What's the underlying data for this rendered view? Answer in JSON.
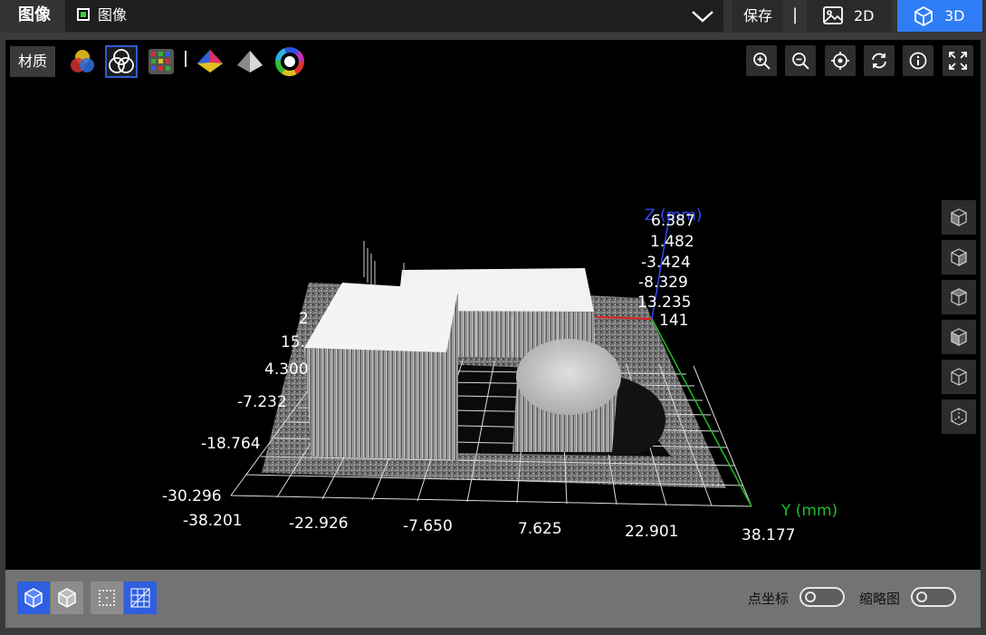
{
  "header": {
    "title": "图像",
    "image_select": {
      "label": "图像",
      "checked": true,
      "check_color": "#39d430"
    },
    "save_label": "保存",
    "separator": "|",
    "btn_2d": "2D",
    "btn_3d": "3D",
    "active_view": "3D",
    "accent": "#2f7df6"
  },
  "toolbar": {
    "material_label": "材质",
    "render_modes": [
      "rgb-channels-icon",
      "grayscale-channels-icon",
      "pseudo-color-grid-icon",
      "height-color-icon",
      "gray-shading-icon",
      "color-wheel-icon"
    ],
    "selected_mode": "grayscale-channels-icon",
    "right_tools": [
      "zoom-in-icon",
      "zoom-out-icon",
      "locate-center-icon",
      "reset-rotation-icon",
      "info-icon",
      "fullscreen-icon"
    ]
  },
  "side_views": [
    "view-front-icon",
    "view-back-icon",
    "view-left-icon",
    "view-right-icon",
    "view-top-icon",
    "view-bottom-icon"
  ],
  "axes": {
    "z_title": "Z (mm)",
    "z_ticks": [
      "6.387",
      "1.482",
      "-3.424",
      "-8.329",
      "13.235",
      "141"
    ],
    "x_ticks": [
      "2",
      "15.",
      "4.300",
      "-7.232",
      "-18.764",
      "-30.296"
    ],
    "y_title": "Y (mm)",
    "y_ticks": [
      "-38.201",
      "-22.926",
      "-7.650",
      "7.625",
      "22.901",
      "38.177"
    ],
    "x_color": "#e02020",
    "y_color": "#1fbf2a",
    "z_color": "#3349ff"
  },
  "bottom": {
    "view_modes": [
      "solid-cube-icon",
      "wire-cube-icon"
    ],
    "grid_modes": [
      "dot-grid-icon",
      "line-grid-icon"
    ],
    "point_coord_label": "点坐标",
    "point_coord_on": false,
    "thumbnail_label": "缩略图",
    "thumbnail_on": false
  }
}
